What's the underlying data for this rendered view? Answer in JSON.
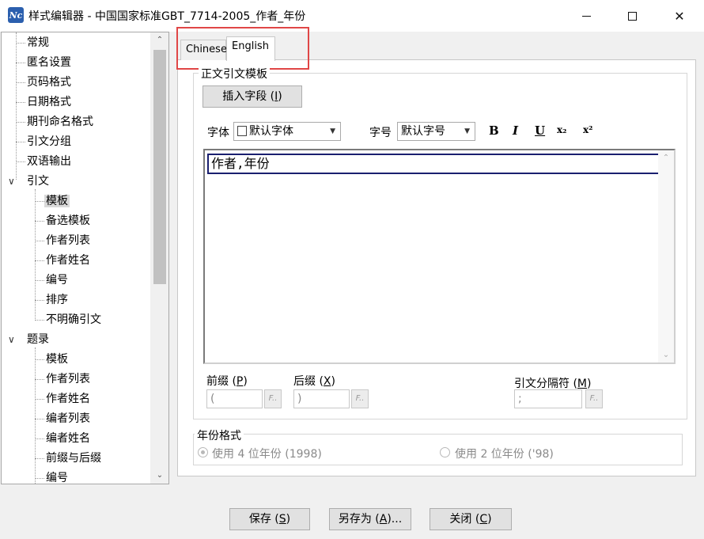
{
  "window": {
    "title": "样式编辑器 - 中国国家标准GBT_7714-2005_作者_年份",
    "app_icon_text": "Nc",
    "minimize_glyph": "",
    "close_glyph": "✕"
  },
  "tree": {
    "items": [
      {
        "label": "常规"
      },
      {
        "label": "匿名设置"
      },
      {
        "label": "页码格式"
      },
      {
        "label": "日期格式"
      },
      {
        "label": "期刊命名格式"
      },
      {
        "label": "引文分组"
      },
      {
        "label": "双语输出"
      },
      {
        "label": "引文",
        "toggle": "∨"
      },
      {
        "label": "模板"
      },
      {
        "label": "备选模板"
      },
      {
        "label": "作者列表"
      },
      {
        "label": "作者姓名"
      },
      {
        "label": "编号"
      },
      {
        "label": "排序"
      },
      {
        "label": "不明确引文"
      },
      {
        "label": "题录",
        "toggle": "∨"
      },
      {
        "label": "模板"
      },
      {
        "label": "作者列表"
      },
      {
        "label": "作者姓名"
      },
      {
        "label": "编者列表"
      },
      {
        "label": "编者姓名"
      },
      {
        "label": "前缀与后缀"
      },
      {
        "label": "编号"
      }
    ],
    "scroll_up": "⌃",
    "scroll_down": "⌄"
  },
  "tabs": [
    {
      "label": "Chinese"
    },
    {
      "label": "English"
    }
  ],
  "template_group": {
    "label": "正文引文模板",
    "insert_field_button": {
      "text": "插入字段 (",
      "key": "I",
      "suffix": ")"
    },
    "font_label": "字体",
    "font_value": "默认字体",
    "size_label": "字号",
    "size_value": "默认字号",
    "bold": "B",
    "italic": "I",
    "underline": "U",
    "subscript": "x₂",
    "superscript": "x²",
    "editor_text": "作者,年份",
    "prefix_label": "前缀 (",
    "prefix_key": "P",
    "prefix_value": "(",
    "suffix_label": "后缀 (",
    "suffix_key": "X",
    "suffix_value": ")",
    "separator_label": "引文分隔符 (",
    "separator_key": "M",
    "separator_value": ";",
    "fx_text": "F.."
  },
  "year_group": {
    "label": "年份格式",
    "option_4digit": "使用 4 位年份 (1998)",
    "option_2digit": "使用 2 位年份 ('98)"
  },
  "footer": {
    "save": {
      "text": "保存 (",
      "key": "S",
      "suffix": ")"
    },
    "save_as": {
      "text": "另存为 (",
      "key": "A",
      "suffix": ")..."
    },
    "close": {
      "text": "关闭 (",
      "key": "C",
      "suffix": ")"
    }
  },
  "colors": {
    "highlight": "#e04646",
    "editor_focus": "#1a1f6f"
  }
}
